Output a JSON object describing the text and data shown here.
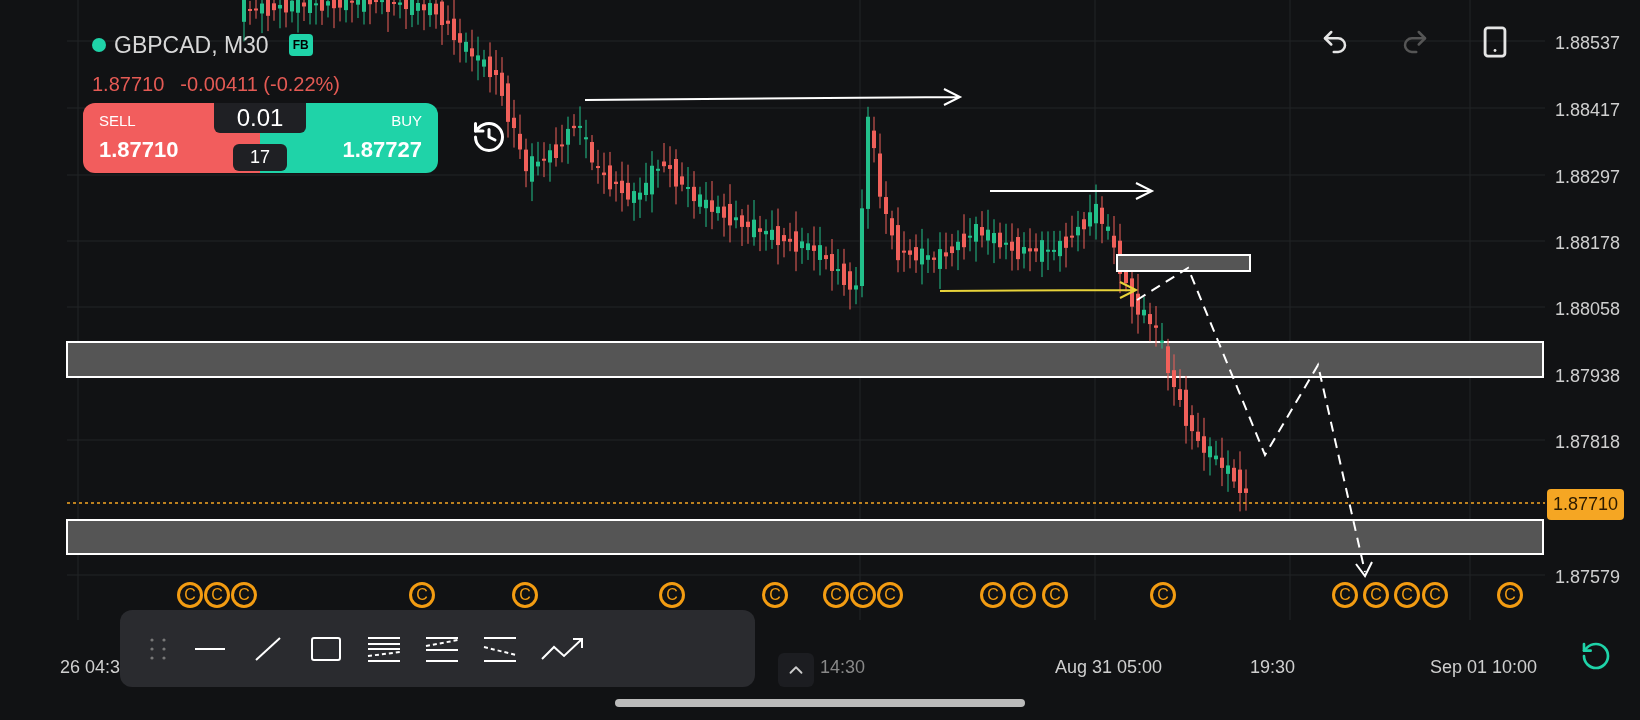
{
  "symbol": {
    "name": "GBPCAD, M30",
    "badge": "FB"
  },
  "quote": {
    "price": "1.87710",
    "change": "-0.00411 (-0.22%)"
  },
  "trade": {
    "sell_label": "SELL",
    "sell_price": "1.87710",
    "lot": "0.01",
    "spread": "17",
    "buy_label": "BUY",
    "buy_price": "1.87727"
  },
  "history_buttons": [
    {
      "kind": "undo",
      "disabled": false
    },
    {
      "kind": "redo",
      "disabled": true
    }
  ],
  "price_axis": [
    "1.88537",
    "1.88417",
    "1.88297",
    "1.88178",
    "1.88058",
    "1.87938",
    "1.87818",
    "1.87579"
  ],
  "current_price": "1.87710",
  "time_axis": [
    "26 04:3",
    "14:30",
    "Aug 31 05:00",
    "19:30",
    "Sep 01 10:00"
  ],
  "event_markers": [
    {
      "label": "C"
    },
    {
      "label": "C"
    },
    {
      "label": "C"
    },
    {
      "label": "C"
    },
    {
      "label": "C"
    },
    {
      "label": "C"
    },
    {
      "label": "C"
    },
    {
      "label": "C"
    },
    {
      "label": "C"
    },
    {
      "label": "C"
    },
    {
      "label": "C"
    },
    {
      "label": "C"
    },
    {
      "label": "C"
    },
    {
      "label": "C"
    },
    {
      "label": "C"
    },
    {
      "label": "C"
    },
    {
      "label": "C"
    },
    {
      "label": "C"
    },
    {
      "label": "C"
    }
  ],
  "drawing_tools": [
    {
      "kind": "handle"
    },
    {
      "kind": "hline"
    },
    {
      "kind": "trend"
    },
    {
      "kind": "rect"
    },
    {
      "kind": "fib1"
    },
    {
      "kind": "fib2"
    },
    {
      "kind": "fib3"
    },
    {
      "kind": "path"
    }
  ]
}
